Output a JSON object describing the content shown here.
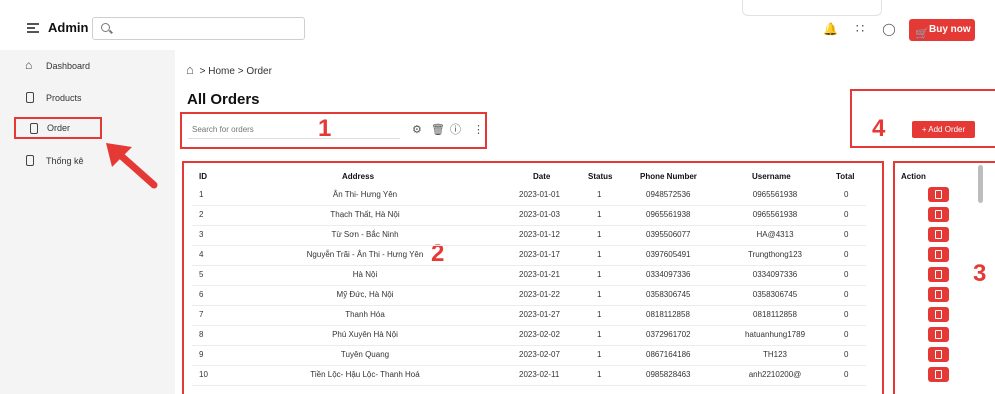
{
  "header": {
    "brand": "Admin",
    "buy_label": "Buy now"
  },
  "sidebar": {
    "items": [
      {
        "label": "Dashboard",
        "icon": "home-icon"
      },
      {
        "label": "Products",
        "icon": "phone-icon"
      },
      {
        "label": "Order",
        "icon": "phone-icon"
      },
      {
        "label": "Thống kê",
        "icon": "phone-icon"
      }
    ]
  },
  "breadcrumb": {
    "home": "Home",
    "sep": ">",
    "current": "Order"
  },
  "page": {
    "title": "All Orders",
    "search_placeholder": "Search for orders",
    "add_label": "+ Add Order"
  },
  "annotations": {
    "n1": "1",
    "n2": "2",
    "n3": "3",
    "n4": "4",
    "accent": "#e53935"
  },
  "table": {
    "columns": [
      "ID",
      "Address",
      "Date",
      "Status",
      "Phone Number",
      "Username",
      "Total",
      "Action"
    ],
    "rows": [
      {
        "id": "1",
        "address": "Ân Thi- Hưng Yên",
        "date": "2023-01-01",
        "status": "1",
        "phone": "0948572536",
        "username": "0965561938",
        "total": "0"
      },
      {
        "id": "2",
        "address": "Thạch Thất, Hà Nội",
        "date": "2023-01-03",
        "status": "1",
        "phone": "0965561938",
        "username": "0965561938",
        "total": "0"
      },
      {
        "id": "3",
        "address": "Từ Sơn - Bắc Ninh",
        "date": "2023-01-12",
        "status": "1",
        "phone": "0395506077",
        "username": "HA@4313",
        "total": "0"
      },
      {
        "id": "4",
        "address": "Nguyễn Trãi - Ân Thi - Hưng Yên",
        "date": "2023-01-17",
        "status": "1",
        "phone": "0397605491",
        "username": "Trungthong123",
        "total": "0"
      },
      {
        "id": "5",
        "address": "Hà Nội",
        "date": "2023-01-21",
        "status": "1",
        "phone": "0334097336",
        "username": "0334097336",
        "total": "0"
      },
      {
        "id": "6",
        "address": "Mỹ Đức, Hà Nội",
        "date": "2023-01-22",
        "status": "1",
        "phone": "0358306745",
        "username": "0358306745",
        "total": "0"
      },
      {
        "id": "7",
        "address": "Thanh Hóa",
        "date": "2023-01-27",
        "status": "1",
        "phone": "0818112858",
        "username": "0818112858",
        "total": "0"
      },
      {
        "id": "8",
        "address": "Phú Xuyên Hà Nội",
        "date": "2023-02-02",
        "status": "1",
        "phone": "0372961702",
        "username": "hatuanhung1789",
        "total": "0"
      },
      {
        "id": "9",
        "address": "Tuyên Quang",
        "date": "2023-02-07",
        "status": "1",
        "phone": "08671641​86",
        "username": "TH123",
        "total": "0"
      },
      {
        "id": "10",
        "address": "Tiền Lộc- Hậu Lộc- Thanh Hoá",
        "date": "2023-02-11",
        "status": "1",
        "phone": "0985828463",
        "username": "anh2210200@",
        "total": "0"
      }
    ]
  }
}
